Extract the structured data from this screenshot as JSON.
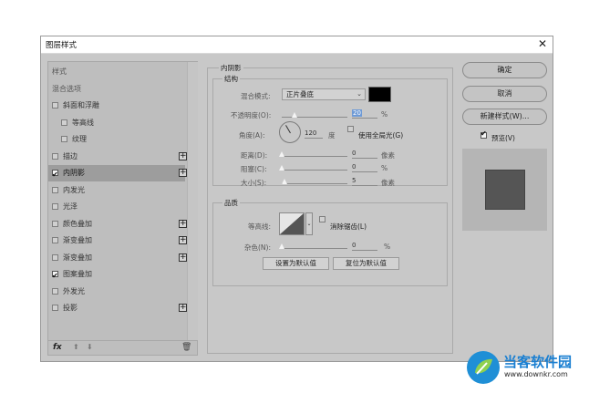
{
  "dialog": {
    "title": "图层样式"
  },
  "left_panel": {
    "items": [
      {
        "label": "样式",
        "kind": "header"
      },
      {
        "label": "混合选项",
        "kind": "header"
      },
      {
        "label": "斜面和浮雕",
        "checked": false,
        "indent": false
      },
      {
        "label": "等高线",
        "checked": false,
        "indent": true
      },
      {
        "label": "纹理",
        "checked": false,
        "indent": true
      },
      {
        "label": "描边",
        "checked": false,
        "indent": false,
        "plus": true
      },
      {
        "label": "内阴影",
        "checked": true,
        "indent": false,
        "plus": true,
        "selected": true
      },
      {
        "label": "内发光",
        "checked": false,
        "indent": false
      },
      {
        "label": "光泽",
        "checked": false,
        "indent": false
      },
      {
        "label": "颜色叠加",
        "checked": false,
        "indent": false,
        "plus": true
      },
      {
        "label": "渐变叠加",
        "checked": false,
        "indent": false,
        "plus": true
      },
      {
        "label": "渐变叠加",
        "checked": false,
        "indent": false,
        "plus": true
      },
      {
        "label": "图案叠加",
        "checked": true,
        "indent": false
      },
      {
        "label": "外发光",
        "checked": false,
        "indent": false
      },
      {
        "label": "投影",
        "checked": false,
        "indent": false,
        "plus": true
      }
    ],
    "bottom": {
      "fx": "fx",
      "up_icon": "arrow-up-icon",
      "down_icon": "arrow-down-icon",
      "trash_icon": "trash-icon"
    }
  },
  "inner_shadow": {
    "section_title": "内阴影",
    "structure_title": "结构",
    "blend_mode_label": "混合模式:",
    "blend_mode_value": "正片叠底",
    "color": "#000000",
    "opacity_label": "不透明度(O):",
    "opacity_value": "20",
    "opacity_unit": "%",
    "opacity_level": 0.2,
    "angle_label": "角度(A):",
    "angle_value": "120",
    "angle_unit": "度",
    "global_light_label": "使用全局光(G)",
    "distance_label": "距离(D):",
    "distance_value": "0",
    "distance_unit": "像素",
    "choke_label": "阻塞(C):",
    "choke_value": "0",
    "choke_unit": "%",
    "size_label": "大小(S):",
    "size_value": "5",
    "size_unit": "像素",
    "quality_title": "品质",
    "contour_label": "等高线:",
    "antialias_label": "消除锯齿(L)",
    "noise_label": "杂色(N):",
    "noise_value": "0",
    "noise_unit": "%",
    "make_default": "设置为默认值",
    "reset_default": "复位为默认值"
  },
  "right_buttons": {
    "ok": "确定",
    "cancel": "取消",
    "new_style": "新建样式(W)...",
    "preview_label": "预览(V)",
    "preview_checked": true
  },
  "watermark": {
    "name": "当客软件园",
    "url": "www.downkr.com"
  }
}
